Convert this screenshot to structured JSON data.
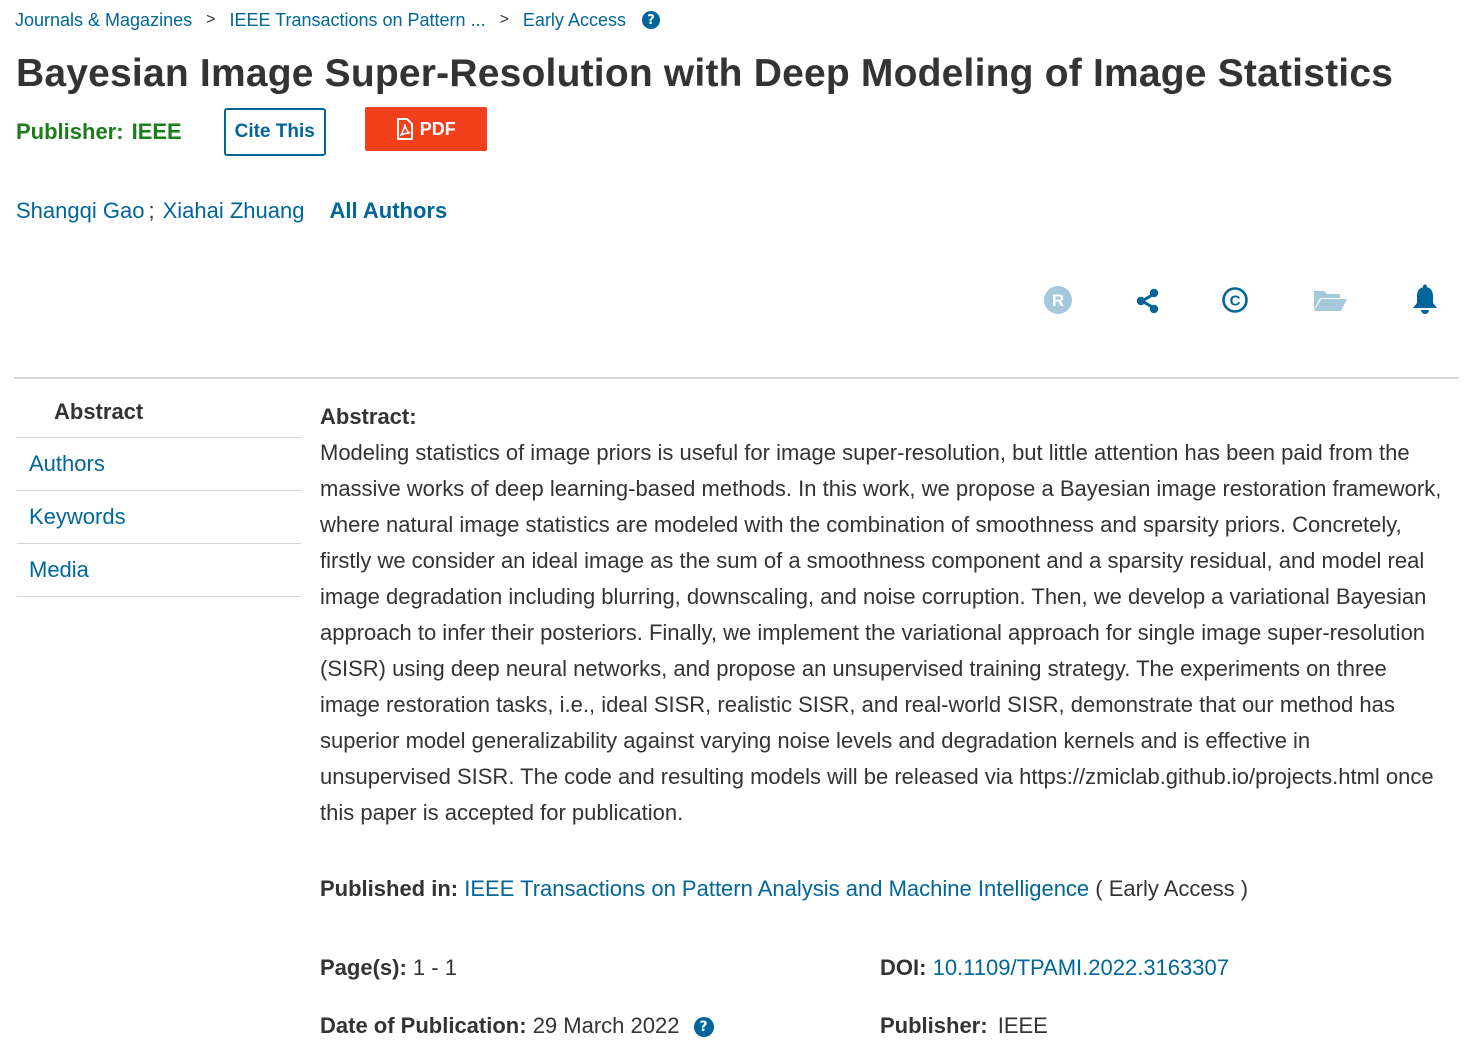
{
  "breadcrumb": {
    "items": [
      "Journals & Magazines",
      "IEEE Transactions on Pattern ...",
      "Early Access"
    ],
    "separator": ">",
    "help_glyph": "?"
  },
  "article": {
    "title": "Bayesian Image Super-Resolution with Deep Modeling of Image Statistics",
    "publisher_label": "Publisher:",
    "publisher_value": "IEEE",
    "cite_label": "Cite This",
    "pdf_label": "PDF",
    "authors": [
      "Shangqi Gao",
      "Xiahai Zhuang"
    ],
    "author_separator": ";",
    "all_authors_label": "All Authors"
  },
  "tools": [
    {
      "icon": "rights-r-icon",
      "glyph": "R",
      "color": "#a6c8dc"
    },
    {
      "icon": "share-icon",
      "color": "#006699"
    },
    {
      "icon": "copyright-icon",
      "glyph": "©",
      "color": "#006699"
    },
    {
      "icon": "folder-icon",
      "color": "#a6c8dc"
    },
    {
      "icon": "bell-icon",
      "color": "#006699"
    }
  ],
  "side_nav": {
    "items": [
      "Abstract",
      "Authors",
      "Keywords",
      "Media"
    ],
    "active": "Abstract"
  },
  "abstract": {
    "heading": "Abstract:",
    "text": "Modeling statistics of image priors is useful for image super-resolution, but little attention has been paid from the massive works of deep learning-based methods. In this work, we propose a Bayesian image restoration framework, where natural image statistics are modeled with the combination of smoothness and sparsity priors. Concretely, firstly we consider an ideal image as the sum of a smoothness component and a sparsity residual, and model real image degradation including blurring, downscaling, and noise corruption. Then, we develop a variational Bayesian approach to infer their posteriors. Finally, we implement the variational approach for single image super-resolution (SISR) using deep neural networks, and propose an unsupervised training strategy. The experiments on three image restoration tasks, i.e., ideal SISR, realistic SISR, and real-world SISR, demonstrate that our method has superior model generalizability against varying noise levels and degradation kernels and is effective in unsupervised SISR. The code and resulting models will be released via https://zmiclab.github.io/projects.html once this paper is accepted for publication."
  },
  "meta": {
    "published_in_label": "Published in:",
    "published_in_value": "IEEE Transactions on Pattern Analysis and Machine Intelligence",
    "published_in_note": "( Early Access )",
    "pages_label": "Page(s):",
    "pages_value": "1 - 1",
    "doi_label": "DOI:",
    "doi_value": "10.1109/TPAMI.2022.3163307",
    "date_label": "Date of Publication:",
    "date_value": "29 March 2022",
    "publisher_label": "Publisher:",
    "publisher_value": "IEEE"
  },
  "colors": {
    "link": "#006699",
    "publisher_green": "#1b7d1b",
    "pdf_button": "#f2401c",
    "divider": "#d6d6d6"
  }
}
